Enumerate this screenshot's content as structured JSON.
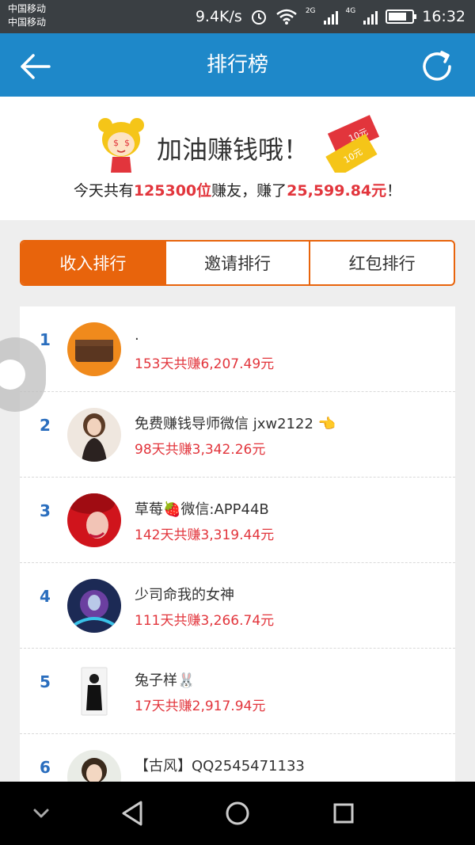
{
  "status": {
    "carrier1": "中国移动",
    "carrier2": "中国移动",
    "speed": "9.4K/s",
    "net2g": "2G",
    "net4g": "4G",
    "time": "16:32"
  },
  "header": {
    "title": "排行榜"
  },
  "banner": {
    "slogan": "加油赚钱哦！",
    "money_label_1": "10元",
    "money_label_2": "10元",
    "summary_prefix": "今天共有",
    "users_count": "125300位",
    "summary_mid": "赚友，赚了",
    "total_amount": "25,599.84元",
    "summary_suffix": "！"
  },
  "tabs": [
    {
      "label": "收入排行",
      "active": true
    },
    {
      "label": "邀请排行",
      "active": false
    },
    {
      "label": "红包排行",
      "active": false
    }
  ],
  "ranking": [
    {
      "rank": "1",
      "name": ".",
      "earn": "153天共赚6,207.49元"
    },
    {
      "rank": "2",
      "name": "免费赚钱导师微信 jxw2122 👈",
      "earn": "98天共赚3,342.26元"
    },
    {
      "rank": "3",
      "name": "草莓🍓微信:APP44B",
      "earn": "142天共赚3,319.44元"
    },
    {
      "rank": "4",
      "name": "少司命我的女神",
      "earn": "111天共赚3,266.74元"
    },
    {
      "rank": "5",
      "name": "兔子样🐰",
      "earn": "17天共赚2,917.94元"
    },
    {
      "rank": "6",
      "name": "【古风】QQ2545471133",
      "earn": ""
    }
  ],
  "colors": {
    "header": "#1e88c9",
    "accent": "#e8640c",
    "highlight": "#e2353c",
    "rank": "#2a6ebe"
  }
}
